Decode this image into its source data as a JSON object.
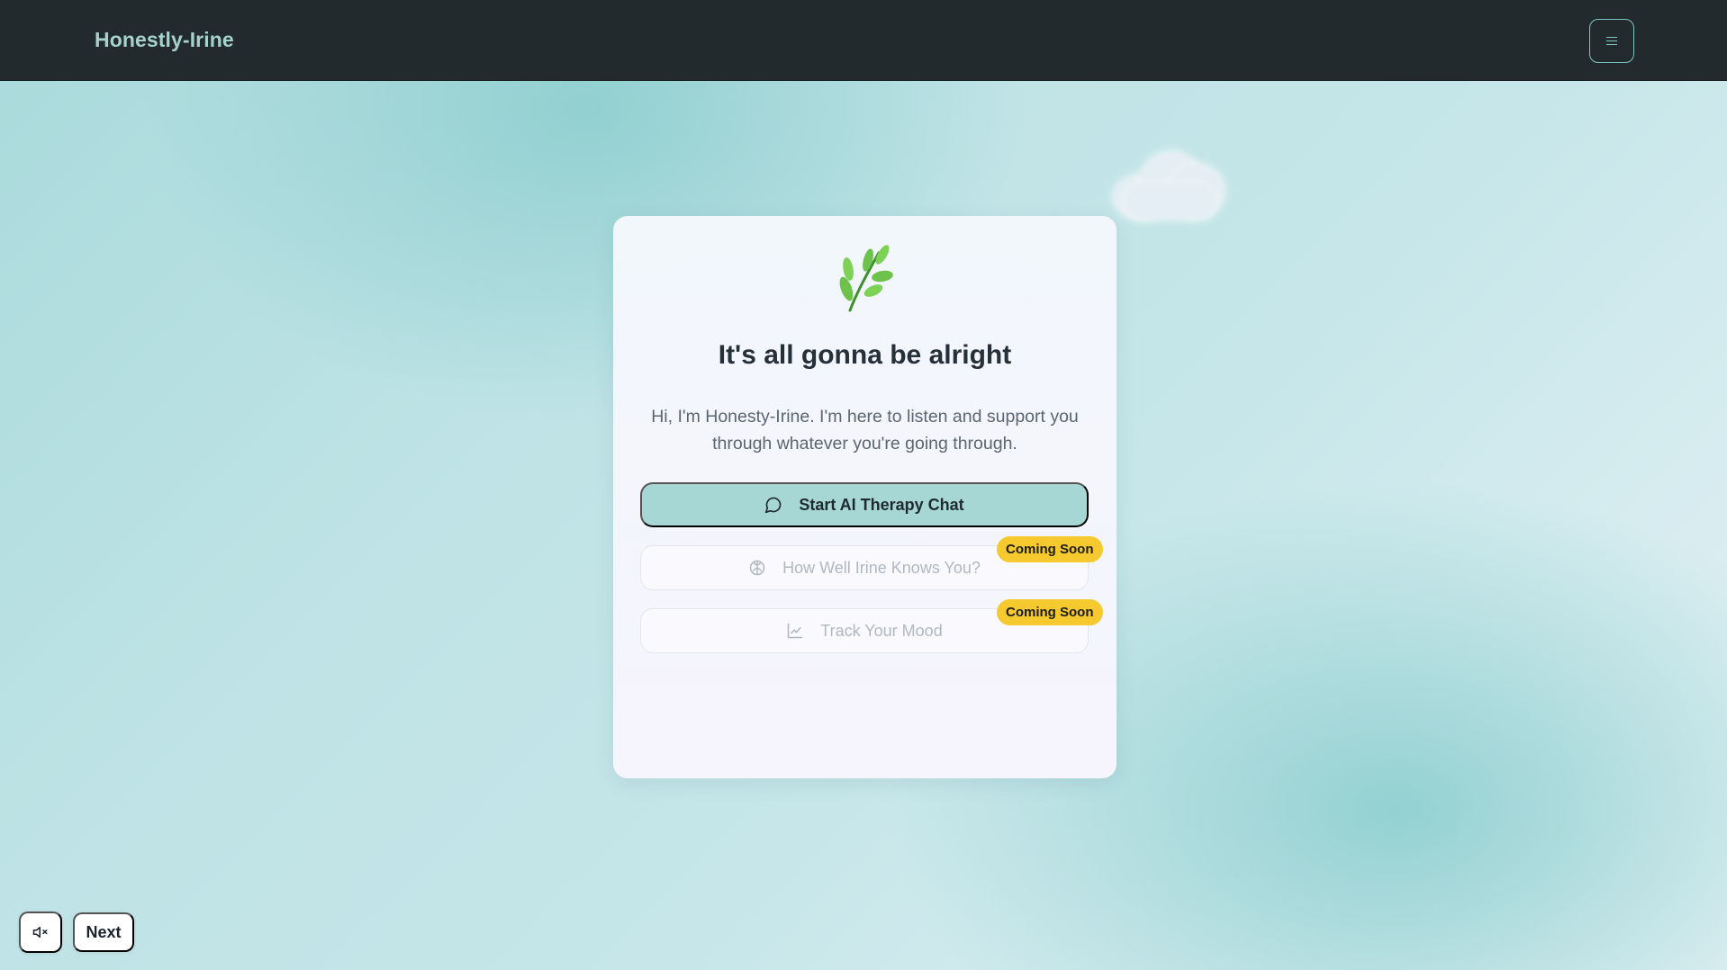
{
  "navbar": {
    "brand": "Honestly-Irine",
    "menu_icon": "hamburger-menu-icon"
  },
  "card": {
    "icon": "leaf-sprig-icon",
    "title": "It's all gonna be alright",
    "description": "Hi, I'm Honesty-Irine. I'm here to listen and support you through whatever you're going through.",
    "actions": [
      {
        "label": "Start AI Therapy Chat",
        "icon": "chat-bubble-icon",
        "enabled": true
      },
      {
        "label": "How Well Irine Knows You?",
        "icon": "brain-icon",
        "enabled": false,
        "badge": "Coming Soon"
      },
      {
        "label": "Track Your Mood",
        "icon": "line-chart-icon",
        "enabled": false,
        "badge": "Coming Soon"
      }
    ]
  },
  "controls": {
    "mute_icon": "speaker-muted-icon",
    "next_label": "Next"
  },
  "colors": {
    "navbar_bg": "#232a2e",
    "brand": "#a5d2cf",
    "primary_button": "#a6d7d4",
    "badge": "#f6c92e",
    "leaf": "#6cc24a"
  }
}
